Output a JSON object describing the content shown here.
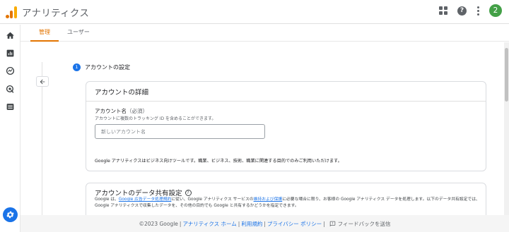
{
  "app": {
    "title": "アナリティクス"
  },
  "header": {
    "avatar_letter": "2",
    "avatar_color": "#43a047"
  },
  "tabs": [
    {
      "label": "管理",
      "active": true
    },
    {
      "label": "ユーザー",
      "active": false
    }
  ],
  "step": {
    "number": "1",
    "title": "アカウントの設定"
  },
  "account_details": {
    "heading": "アカウントの詳細",
    "name_label": "アカウント名",
    "name_required": "（必須）",
    "name_help": "アカウントに複数のトラッキング ID を含めることができます。",
    "name_placeholder": "新しいアカウント名",
    "name_value": "",
    "note": "Google アナリティクスはビジネス向けツールです。職業、ビジネス、技術、職業に関連する目的でのみご利用いただけます。"
  },
  "data_sharing": {
    "heading": "アカウントのデータ共有設定",
    "body_prefix": "Google は、",
    "link_terms": "Google 広告データ処理規約",
    "body_mid1": "に従い、Google アナリティクス サービスの",
    "link_maintenance": "維持および保護",
    "body_mid2": "に必要な場合に限り、お客様の Google アナリティクス データを処理します。以下のデータ共有設定では、Google アナリティクスで収集したデータを、その他の目的でも Google と共有するかどうかを指定できます。"
  },
  "footer": {
    "copyright": "©2023 Google",
    "links": [
      "アナリティクス ホーム",
      "利用規約",
      "プライバシー ポリシー"
    ],
    "feedback": "フィードバックを送信"
  },
  "colors": {
    "accent": "#e37400",
    "primary_blue": "#1a73e8"
  }
}
